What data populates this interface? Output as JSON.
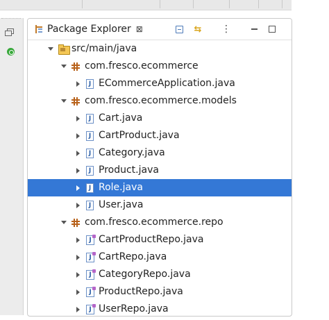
{
  "view": {
    "title": "Package Explorer",
    "close_glyph": "⊠"
  },
  "icons": {
    "view_tab": "package-explorer-icon",
    "close": "close-icon",
    "collapse_all": "collapse-all-icon",
    "link_editor": "link-with-editor-icon",
    "view_menu": "view-menu-icon",
    "minimize": "minimize-icon",
    "maximize": "maximize-icon",
    "trim_restore": "restore-icon",
    "trim_power": "power-icon"
  },
  "colors": {
    "selection": "#3478d6",
    "package_icon": "#b8621b",
    "java_icon": "#2b5fa7"
  },
  "tree": {
    "source_folder": "src/main/java",
    "packages": [
      {
        "name": "com.fresco.ecommerce",
        "files": [
          {
            "name": "ECommerceApplication.java",
            "kind": "class"
          }
        ]
      },
      {
        "name": "com.fresco.ecommerce.models",
        "files": [
          {
            "name": "Cart.java",
            "kind": "class"
          },
          {
            "name": "CartProduct.java",
            "kind": "class"
          },
          {
            "name": "Category.java",
            "kind": "class"
          },
          {
            "name": "Product.java",
            "kind": "class"
          },
          {
            "name": "Role.java",
            "kind": "class",
            "selected": true
          },
          {
            "name": "User.java",
            "kind": "class"
          }
        ]
      },
      {
        "name": "com.fresco.ecommerce.repo",
        "files": [
          {
            "name": "CartProductRepo.java",
            "kind": "interface"
          },
          {
            "name": "CartRepo.java",
            "kind": "interface"
          },
          {
            "name": "CategoryRepo.java",
            "kind": "interface"
          },
          {
            "name": "ProductRepo.java",
            "kind": "interface"
          },
          {
            "name": "UserRepo.java",
            "kind": "interface"
          }
        ]
      }
    ]
  }
}
